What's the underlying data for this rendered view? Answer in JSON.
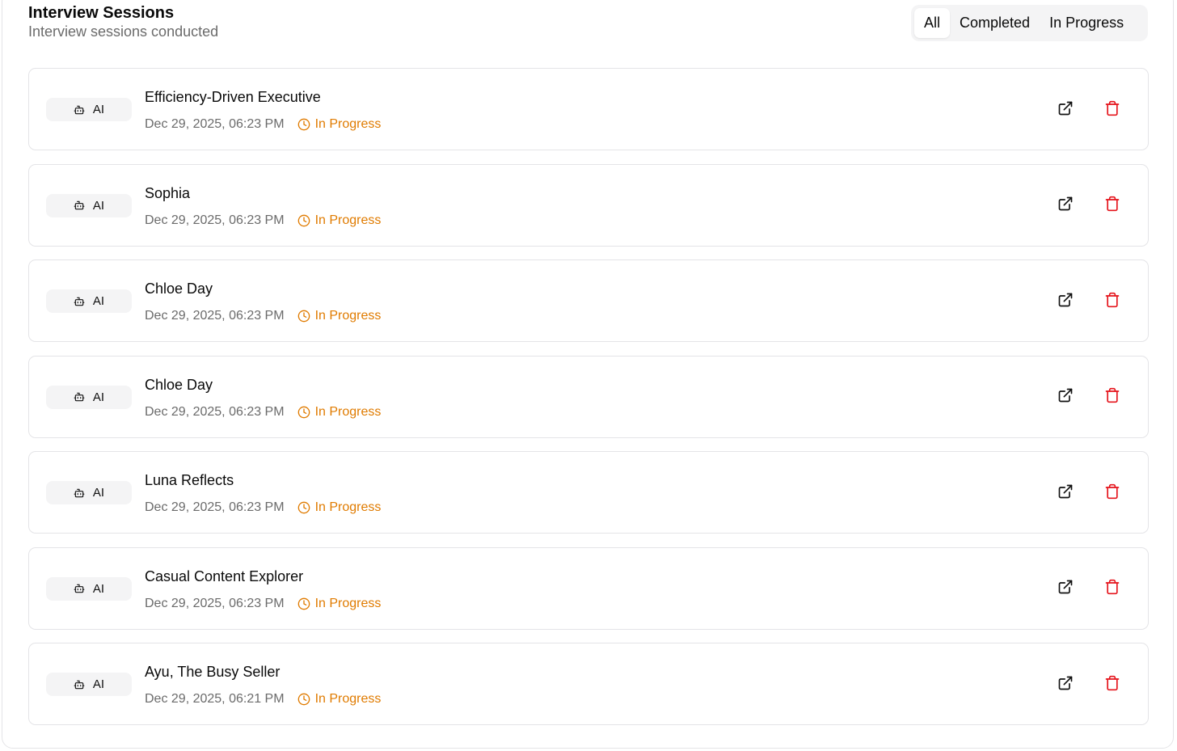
{
  "header": {
    "title": "Interview Sessions",
    "subtitle": "Interview sessions conducted"
  },
  "filters": {
    "active": "All",
    "tabs": [
      "All",
      "Completed",
      "In Progress"
    ]
  },
  "colors": {
    "status_in_progress": "#e07b00",
    "delete_icon": "#e5141c",
    "badge_bg": "#f4f4f5"
  },
  "icons": {
    "badge": "bot-icon",
    "status": "clock-icon",
    "open": "external-link-icon",
    "delete": "trash-icon"
  },
  "sessions": [
    {
      "badge": "AI",
      "title": "Efficiency-Driven Executive",
      "date": "Dec 29, 2025, 06:23 PM",
      "status": "In Progress"
    },
    {
      "badge": "AI",
      "title": "Sophia",
      "date": "Dec 29, 2025, 06:23 PM",
      "status": "In Progress"
    },
    {
      "badge": "AI",
      "title": "Chloe Day",
      "date": "Dec 29, 2025, 06:23 PM",
      "status": "In Progress"
    },
    {
      "badge": "AI",
      "title": "Chloe Day",
      "date": "Dec 29, 2025, 06:23 PM",
      "status": "In Progress"
    },
    {
      "badge": "AI",
      "title": "Luna Reflects",
      "date": "Dec 29, 2025, 06:23 PM",
      "status": "In Progress"
    },
    {
      "badge": "AI",
      "title": "Casual Content Explorer",
      "date": "Dec 29, 2025, 06:23 PM",
      "status": "In Progress"
    },
    {
      "badge": "AI",
      "title": "Ayu, The Busy Seller",
      "date": "Dec 29, 2025, 06:21 PM",
      "status": "In Progress"
    }
  ]
}
